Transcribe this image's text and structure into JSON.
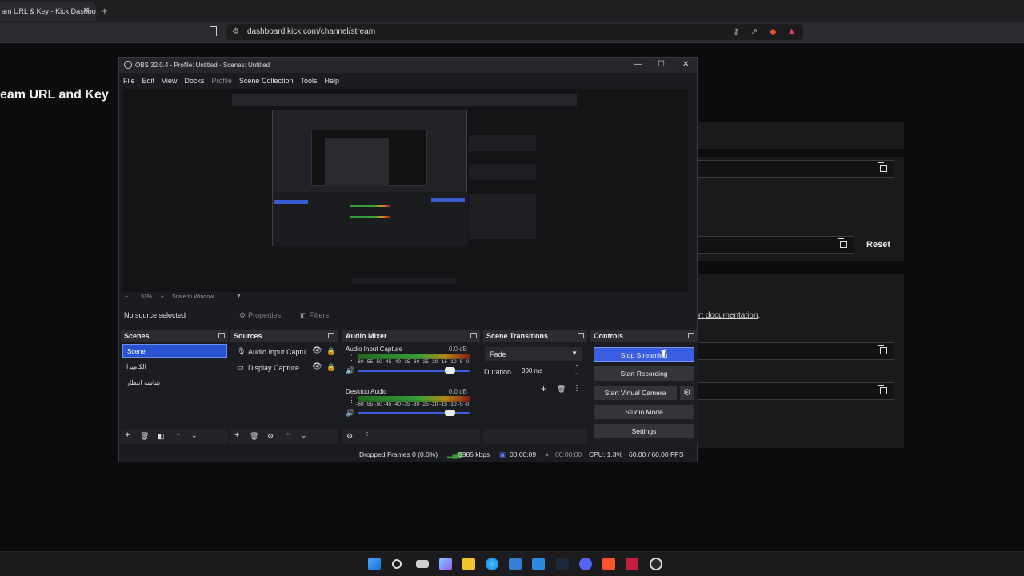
{
  "browser": {
    "tab_title": "am URL & Key - Kick Dashbo",
    "tab_close": "✕",
    "new_tab": "+",
    "url": "dashboard.kick.com/channel/stream"
  },
  "webpage": {
    "heading": "eam URL and Key",
    "reset_label": "Reset",
    "doc_prefix": "rt ",
    "doc_link": "documentation",
    "doc_suffix": "."
  },
  "obs": {
    "title": "OBS 32.0.4 - Profile: Untitled - Scenes: Untitled",
    "menu": [
      "File",
      "Edit",
      "View",
      "Docks",
      "Profile",
      "Scene Collection",
      "Tools",
      "Help"
    ],
    "zoom_minus": "−",
    "zoom_level": "33%",
    "zoom_plus": "+",
    "scale_mode": "Scale to Window",
    "no_source": "No source selected",
    "properties_label": "Properties",
    "filters_label": "Filters",
    "docks": {
      "scenes": "Scenes",
      "sources": "Sources",
      "mixer": "Audio Mixer",
      "transitions": "Scene Transitions",
      "controls": "Controls"
    },
    "scenes": [
      "Scene",
      "الكاميرا",
      "شاشة انتظار"
    ],
    "sources": [
      {
        "label": "Audio Input Captu",
        "icon": "microphone-icon"
      },
      {
        "label": "Display Capture",
        "icon": "monitor-icon"
      }
    ],
    "mixer": [
      {
        "name": "Audio Input Capture",
        "db": "0.0 dB",
        "level": 0.78
      },
      {
        "name": "Desktop Audio",
        "db": "0.0 dB",
        "level": 0.72
      }
    ],
    "meter_scale": "-60 -55 -50 -45 -40 -35 -30 -25 -20 -15 -10 -5 -0",
    "transition": {
      "name": "Fade",
      "duration_label": "Duration",
      "duration": "300 ms"
    },
    "controls": {
      "stop_streaming": "Stop Streaming",
      "start_recording": "Start Recording",
      "start_virtual_camera": "Start Virtual Camera",
      "studio_mode": "Studio Mode",
      "settings": "Settings"
    },
    "status": {
      "dropped": "Dropped Frames 0 (0.0%)",
      "bitrate": "5985 kbps",
      "stream_time": "00:00:09",
      "rec_time": "00:00:00",
      "cpu": "CPU: 1.3%",
      "fps": "60.00 / 60.00 FPS"
    }
  },
  "colors": {
    "accent": "#3b5ee0",
    "scene_selected": "#2852d0",
    "meter_green": "#3a9e3a",
    "meter_yellow": "#b08a14",
    "meter_red": "#8a1a1a"
  }
}
